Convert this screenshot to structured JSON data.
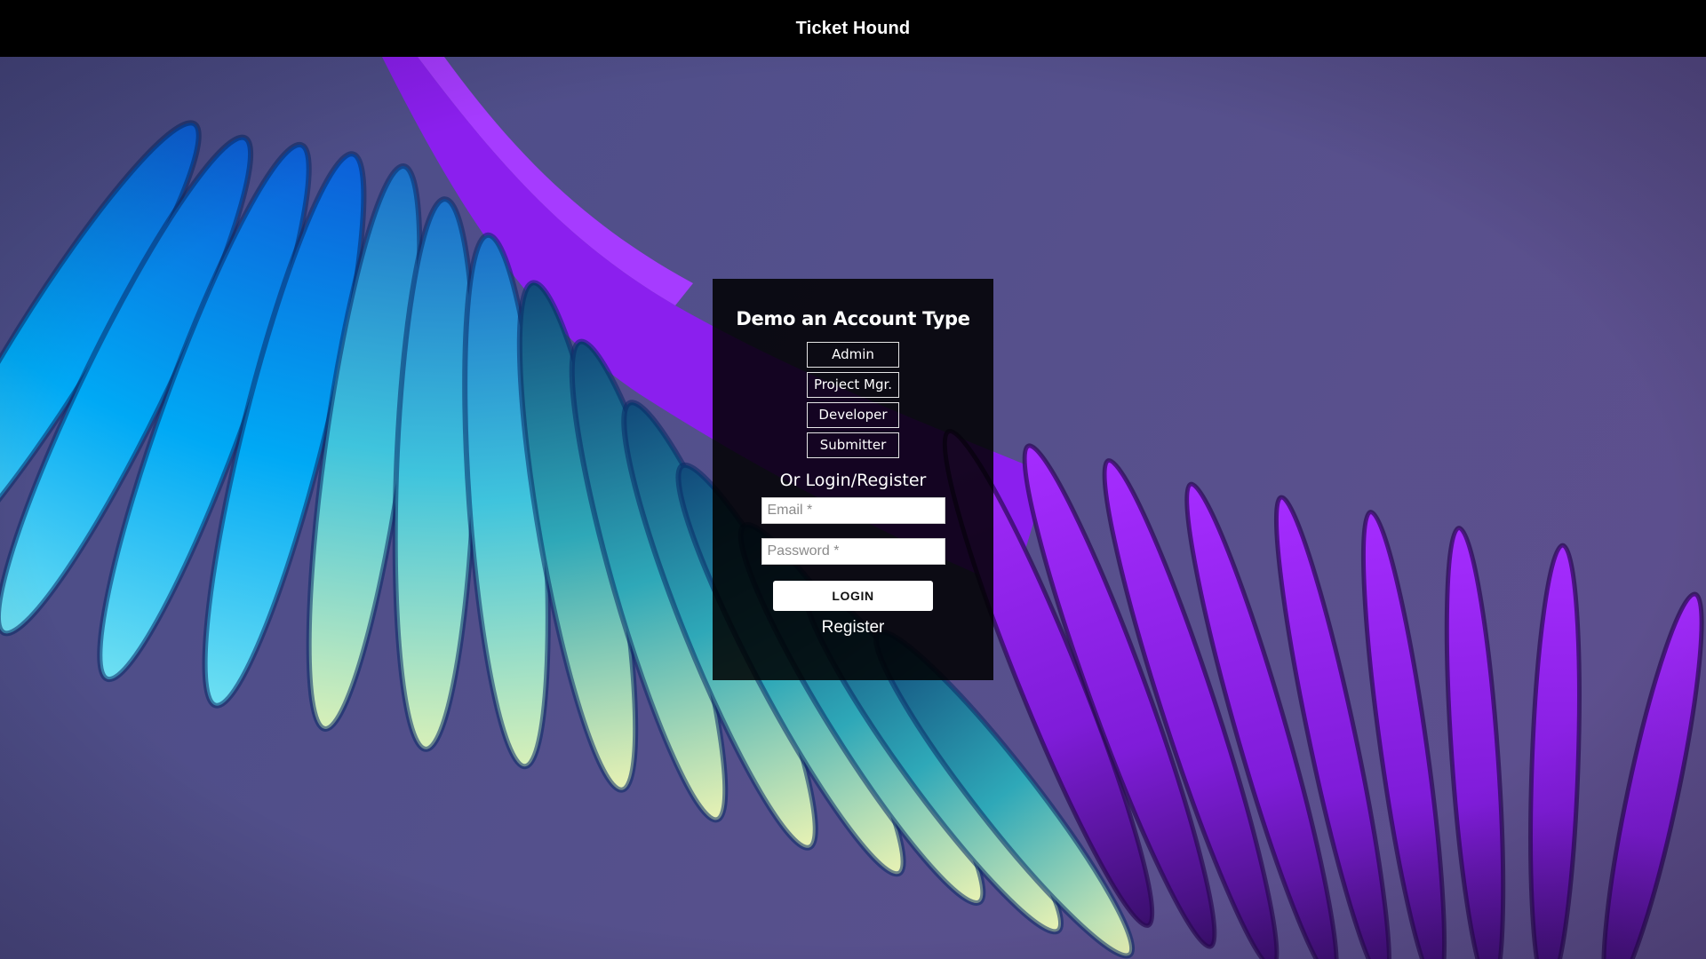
{
  "header": {
    "title": "Ticket Hound"
  },
  "login_panel": {
    "heading": "Demo an Account Type",
    "demo_buttons": [
      {
        "label": "Admin"
      },
      {
        "label": "Project Mgr."
      },
      {
        "label": "Developer"
      },
      {
        "label": "Submitter"
      }
    ],
    "or_label": "Or Login/Register",
    "email": {
      "placeholder": "Email *",
      "value": ""
    },
    "password": {
      "placeholder": "Password *",
      "value": ""
    },
    "login_label": "LOGIN",
    "register_label": "Register"
  },
  "colors": {
    "topbar": "#000000",
    "panel": "#0d0d0d",
    "blue_accent": "#00a8ff",
    "purple_accent": "#8a1ee6"
  }
}
